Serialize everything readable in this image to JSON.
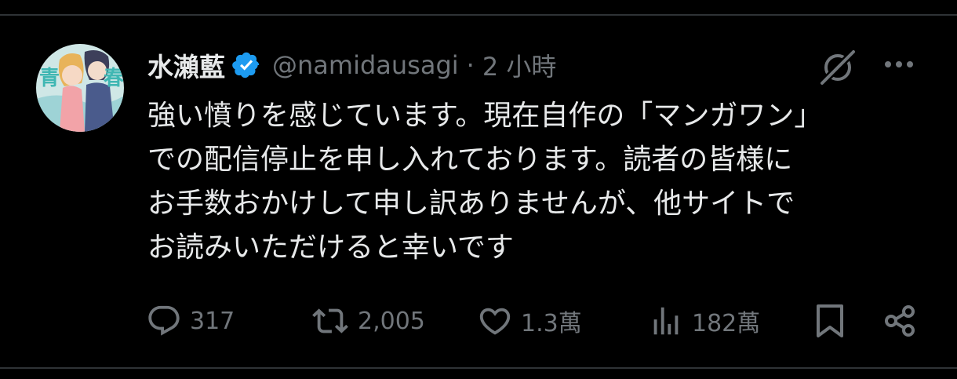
{
  "tweet": {
    "display_name": "水瀨藍",
    "handle": "@namidausagi",
    "separator": "·",
    "time": "2 小時",
    "text": "強い憤りを感じています。現在自作の「マンガワン」\nでの配信停止を申し入れております。読者の皆様に\nお手数おかけして申し訳ありませんが、他サイトで\nお読みいただけると幸いです"
  },
  "metrics": {
    "replies": "317",
    "reposts": "2,005",
    "likes": "1.3萬",
    "views": "182萬"
  },
  "icons": {
    "verified": "verified-badge-icon",
    "grok": "grok-icon",
    "more": "more-icon",
    "reply": "reply-icon",
    "repost": "repost-icon",
    "like": "like-icon",
    "views": "views-icon",
    "bookmark": "bookmark-icon",
    "share": "share-icon"
  },
  "colors": {
    "background": "#000000",
    "text": "#e7e9ea",
    "secondary": "#71767b",
    "verified": "#1d9bf0"
  }
}
